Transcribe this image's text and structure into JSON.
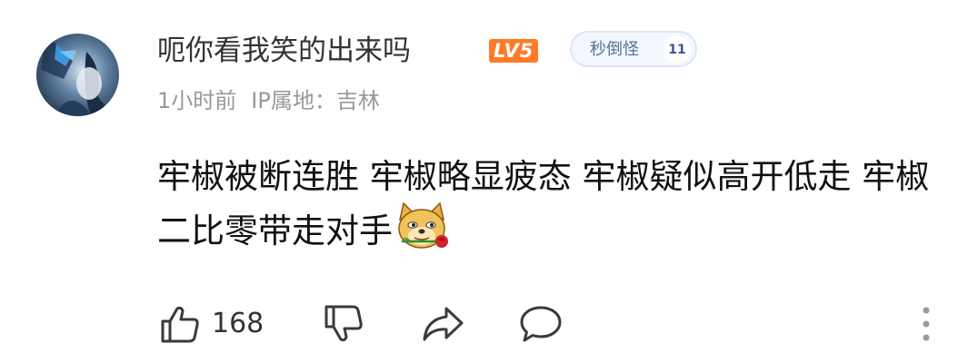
{
  "comment": {
    "username": "呃你看我笑的出来吗",
    "level_badge": "LV5",
    "medal": {
      "name": "秒倒怪",
      "level": "11"
    },
    "time": "1小时前",
    "ip_location": "IP属地：吉林",
    "text": "牢椒被断连胜 牢椒略显疲态 牢椒疑似高开低走 牢椒二比零带走对手",
    "emoji": "doge-with-rose",
    "like_count": "168"
  },
  "icons": {
    "like": "thumbs-up-icon",
    "dislike": "thumbs-down-icon",
    "share": "share-icon",
    "reply": "comment-bubble-icon",
    "more": "more-vertical-icon"
  },
  "colors": {
    "level_badge": "#ff7a26",
    "medal_text": "#5b6f95",
    "medal_bg": "#f3f7fe",
    "meta_text": "#999999"
  }
}
